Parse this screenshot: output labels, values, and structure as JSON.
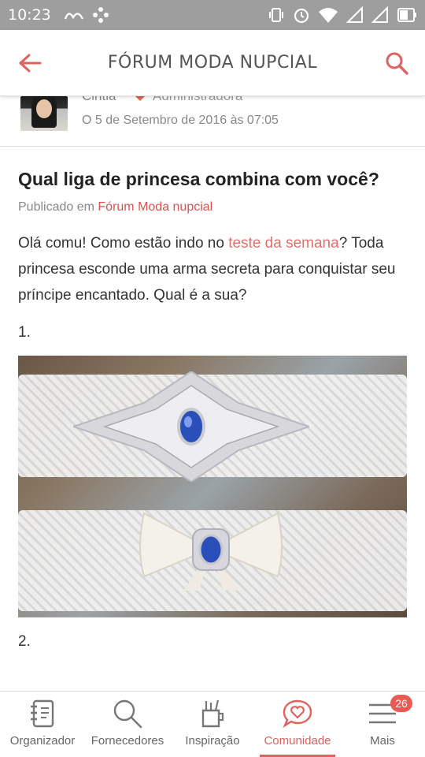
{
  "status_bar": {
    "time": "10:23"
  },
  "header": {
    "title": "FÓRUM MODA NUPCIAL"
  },
  "author": {
    "name": "Cintia",
    "role": "Administradora",
    "date": "O 5 de Setembro de 2016 às 07:05"
  },
  "post": {
    "title": "Qual liga de princesa combina com você?",
    "published_prefix": "Publicado em ",
    "published_forum": "Fórum Moda nupcial",
    "intro_1": "Olá comu! Como estão indo no ",
    "intro_link": "teste da semana",
    "intro_2": "? Toda princesa esconde uma arma secreta para conquistar seu príncipe encantado. Qual é a sua?",
    "item_1": "1.",
    "item_2": "2."
  },
  "nav": {
    "items": [
      {
        "label": "Organizador",
        "icon": "notebook-icon"
      },
      {
        "label": "Fornecedores",
        "icon": "search-icon"
      },
      {
        "label": "Inspiração",
        "icon": "pencil-cup-icon"
      },
      {
        "label": "Comunidade",
        "icon": "chat-heart-icon",
        "active": true
      },
      {
        "label": "Mais",
        "icon": "menu-icon",
        "badge": "26"
      }
    ]
  },
  "colors": {
    "accent": "#e0625c",
    "status_bar": "#9e9e9e"
  }
}
